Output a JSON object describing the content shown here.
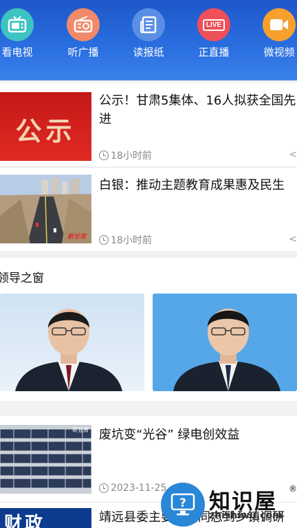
{
  "nav": {
    "items": [
      {
        "label": "看电视",
        "icon": "tv-icon",
        "color": "#3ec3c3"
      },
      {
        "label": "听广播",
        "icon": "radio-icon",
        "color": "#f08a6a"
      },
      {
        "label": "读报纸",
        "icon": "newspaper-icon",
        "color": "#5b8fe6"
      },
      {
        "label": "正直播",
        "icon": "live-icon",
        "color": "#ee4f58",
        "badge": "LIVE"
      },
      {
        "label": "微视频",
        "icon": "video-camera-icon",
        "color": "#f7a02e"
      }
    ]
  },
  "news": [
    {
      "title": "公示！甘肃5集体、16人拟获全国先进",
      "thumb_text": "公示",
      "time": "18小时前"
    },
    {
      "title": "白银：推动主题教育成果惠及民生",
      "thumb_caption": "新甘肃",
      "time": "18小时前"
    },
    {
      "title": "废坑变“光谷”  绿电创效益",
      "thumb_caption": "新甘肃",
      "time": "2023-11-25"
    },
    {
      "title": "靖远县委主要负责同志到乡镇调研",
      "thumb_text": "财政"
    }
  ],
  "leaders": {
    "section_title": "领导之窗"
  },
  "watermark": {
    "name": "知识屋",
    "reg": "®",
    "url": "zhishiwu.com"
  }
}
